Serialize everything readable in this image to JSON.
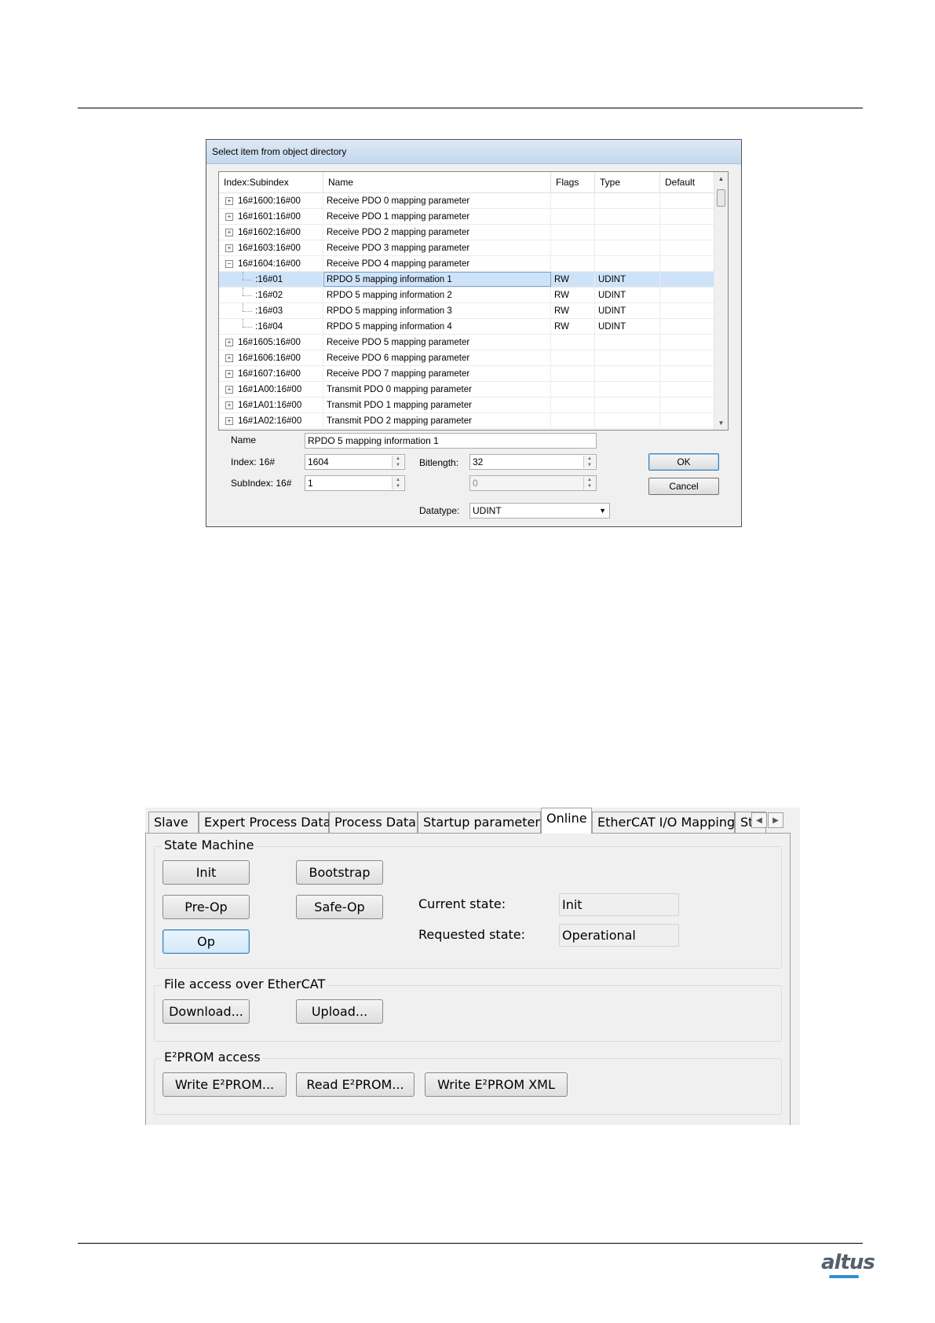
{
  "dialog1": {
    "title": "Select item from object directory",
    "columns": [
      "Index:Subindex",
      "Name",
      "Flags",
      "Type",
      "Default"
    ],
    "rows": [
      {
        "expander": "+",
        "index": "16#1600:16#00",
        "name": "Receive PDO 0 mapping parameter",
        "flags": "",
        "type": ""
      },
      {
        "expander": "+",
        "index": "16#1601:16#00",
        "name": "Receive PDO 1 mapping parameter",
        "flags": "",
        "type": ""
      },
      {
        "expander": "+",
        "index": "16#1602:16#00",
        "name": "Receive PDO 2 mapping parameter",
        "flags": "",
        "type": ""
      },
      {
        "expander": "+",
        "index": "16#1603:16#00",
        "name": "Receive PDO 3 mapping parameter",
        "flags": "",
        "type": ""
      },
      {
        "expander": "−",
        "index": "16#1604:16#00",
        "name": "Receive PDO 4 mapping parameter",
        "flags": "",
        "type": ""
      },
      {
        "expander": "",
        "index": ":16#01",
        "name": "RPDO 5 mapping information 1",
        "flags": "RW",
        "type": "UDINT"
      },
      {
        "expander": "",
        "index": ":16#02",
        "name": "RPDO 5 mapping information 2",
        "flags": "RW",
        "type": "UDINT"
      },
      {
        "expander": "",
        "index": ":16#03",
        "name": "RPDO 5 mapping information 3",
        "flags": "RW",
        "type": "UDINT"
      },
      {
        "expander": "",
        "index": ":16#04",
        "name": "RPDO 5 mapping information 4",
        "flags": "RW",
        "type": "UDINT"
      },
      {
        "expander": "+",
        "index": "16#1605:16#00",
        "name": "Receive PDO 5 mapping parameter",
        "flags": "",
        "type": ""
      },
      {
        "expander": "+",
        "index": "16#1606:16#00",
        "name": "Receive PDO 6 mapping parameter",
        "flags": "",
        "type": ""
      },
      {
        "expander": "+",
        "index": "16#1607:16#00",
        "name": "Receive PDO 7 mapping parameter",
        "flags": "",
        "type": ""
      },
      {
        "expander": "+",
        "index": "16#1A00:16#00",
        "name": "Transmit PDO 0 mapping parameter",
        "flags": "",
        "type": ""
      },
      {
        "expander": "+",
        "index": "16#1A01:16#00",
        "name": "Transmit PDO 1 mapping parameter",
        "flags": "",
        "type": ""
      },
      {
        "expander": "+",
        "index": "16#1A02:16#00",
        "name": "Transmit PDO 2 mapping parameter",
        "flags": "",
        "type": ""
      }
    ],
    "selected_row": 5,
    "form": {
      "name_label": "Name",
      "name_value": "RPDO 5 mapping information 1",
      "index_label": "Index:  16#",
      "index_value": "1604",
      "subindex_label": "SubIndex:  16#",
      "subindex_value": "1",
      "bitlength_label": "Bitlength:",
      "bitlength_value": "32",
      "disabled_value": "0",
      "datatype_label": "Datatype:",
      "datatype_value": "UDINT"
    },
    "ok_label": "OK",
    "cancel_label": "Cancel"
  },
  "dialog2": {
    "tabs": [
      "Slave",
      "Expert Process Data",
      "Process Data",
      "Startup parameters",
      "Online",
      "EtherCAT I/O Mapping",
      "St"
    ],
    "active_tab": "Online",
    "state_machine": {
      "title": "State Machine",
      "buttons": [
        "Init",
        "Bootstrap",
        "Pre-Op",
        "Safe-Op",
        "Op"
      ],
      "current_state_label": "Current state:",
      "current_state_value": "Init",
      "requested_state_label": "Requested state:",
      "requested_state_value": "Operational"
    },
    "file_access": {
      "title": "File access over EtherCAT",
      "download_label": "Download...",
      "upload_label": "Upload..."
    },
    "eeprom": {
      "title": "E²PROM access",
      "write_label": "Write E²PROM...",
      "read_label": "Read E²PROM...",
      "write_xml_label": "Write E²PROM XML"
    }
  },
  "footer": {
    "logo_text": "altus"
  }
}
